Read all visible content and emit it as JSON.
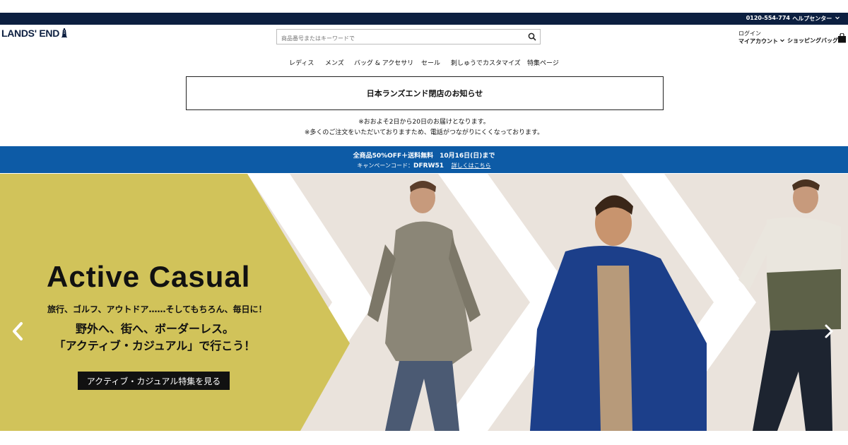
{
  "utility_bar": {
    "phone": "0120-554-774",
    "help": "ヘルプセンター"
  },
  "header": {
    "logo": "LANDS' END",
    "search_placeholder": "商品番号またはキーワードで",
    "login": "ログイン",
    "my_account": "マイアカウント",
    "shopping_bag": "ショッピングバッグ"
  },
  "nav": {
    "items": [
      "レディス",
      "メンズ",
      "バッグ & アクセサリ",
      "セール",
      "刺しゅうでカスタマイズ",
      "特集ページ"
    ]
  },
  "notice": {
    "title": "日本ランズエンド閉店のお知らせ",
    "line1": "※おおよそ2日から20日のお届けとなります。",
    "line2": "※多くのご注文をいただいておりますため、電話がつながりにくくなっております。"
  },
  "promo": {
    "line1": "全商品50%OFF＋送料無料　10月16日(日)まで",
    "code_label": "キャンペーンコード：",
    "code": "DFRW51",
    "link": "詳しくはこちら"
  },
  "hero": {
    "title": "Active Casual",
    "subtitle1": "旅行、ゴルフ、アウトドア……そしてもちろん、毎日に！",
    "subtitle2_line1": "野外へ、街へ、ボーダーレス。",
    "subtitle2_line2": "「アクティブ・カジュアル」で行こう！",
    "cta": "アクティブ・カジュアル特集を見る"
  },
  "colors": {
    "utility_bar": "#0c1f40",
    "promo_bar": "#0d5ba6",
    "hero_panel": "#d1c35a",
    "hero_bg": "#eae3dc"
  },
  "icons": [
    "lighthouse-icon",
    "search-icon",
    "chevron-down-icon",
    "shopping-bag-icon",
    "carousel-prev-icon",
    "carousel-next-icon"
  ]
}
